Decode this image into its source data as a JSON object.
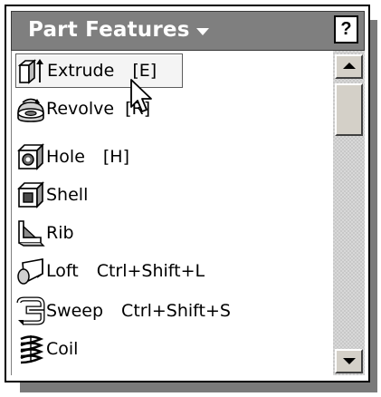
{
  "panel": {
    "title": "Part Features",
    "help_label": "?"
  },
  "items": [
    {
      "label": "Extrude",
      "shortcut": "[E]",
      "icon": "extrude-icon",
      "selected": true
    },
    {
      "label": "Revolve",
      "shortcut": "[R]",
      "icon": "revolve-icon"
    },
    {
      "label": "Hole",
      "shortcut": "[H]",
      "icon": "hole-icon"
    },
    {
      "label": "Shell",
      "shortcut": "",
      "icon": "shell-icon"
    },
    {
      "label": "Rib",
      "shortcut": "",
      "icon": "rib-icon"
    },
    {
      "label": "Loft",
      "shortcut": "Ctrl+Shift+L",
      "icon": "loft-icon"
    },
    {
      "label": "Sweep",
      "shortcut": "Ctrl+Shift+S",
      "icon": "sweep-icon"
    },
    {
      "label": "Coil",
      "shortcut": "",
      "icon": "coil-icon"
    }
  ]
}
